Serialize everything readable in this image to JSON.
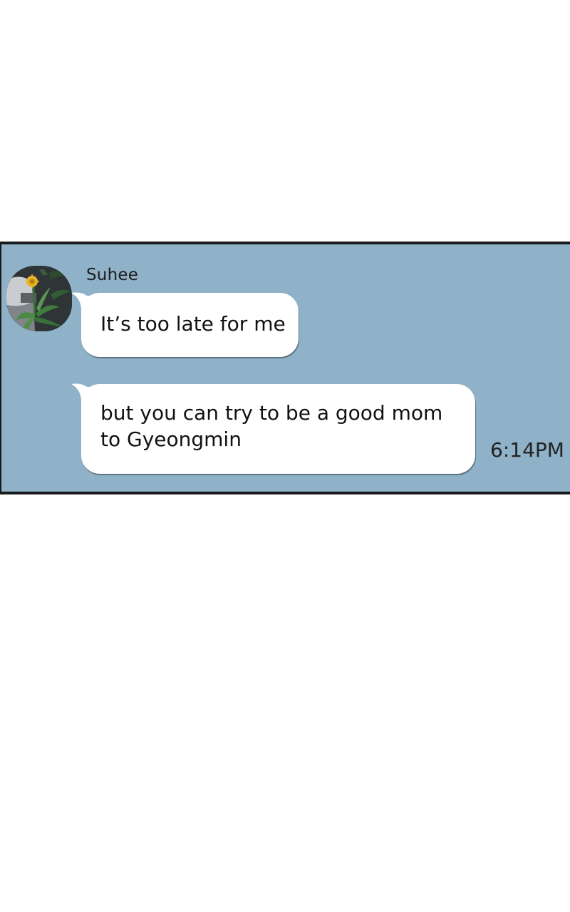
{
  "conversation": {
    "sender_name": "Suhee",
    "messages": [
      {
        "text": "It’s too late for me"
      },
      {
        "text": "but you can try to be a good mom to Gyeongmin"
      }
    ],
    "timestamp": "6:14PM"
  },
  "colors": {
    "chat_background": "#8fb2c8",
    "bubble": "#ffffff",
    "border": "#1a1a1a",
    "page_background": "#ffffff"
  },
  "avatar": {
    "icon": "flower-plant-avatar-icon"
  }
}
